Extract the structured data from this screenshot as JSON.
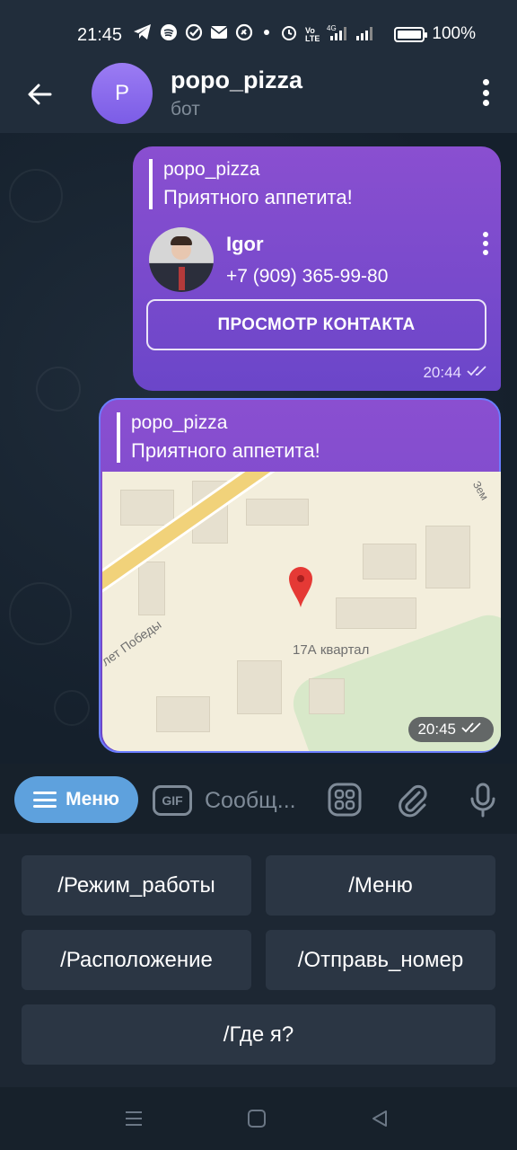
{
  "status_bar": {
    "time": "21:45",
    "battery": "100%",
    "icons": [
      "telegram-icon",
      "spotify-icon",
      "check-circle-icon",
      "mail-icon",
      "shazam-icon",
      "dot-icon",
      "alarm-icon",
      "volte-icon",
      "signal-4g-icon",
      "signal-icon",
      "battery-icon"
    ]
  },
  "header": {
    "avatar_letter": "P",
    "title": "popo_pizza",
    "subtitle": "бот"
  },
  "messages": [
    {
      "reply_name": "popo_pizza",
      "reply_text": "Приятного аппетита!",
      "contact_name": "Igor",
      "contact_phone": "+7 (909) 365-99-80",
      "view_contact_label": "ПРОСМОТР КОНТАКТА",
      "time": "20:44"
    },
    {
      "reply_name": "popo_pizza",
      "reply_text": "Приятного аппетита!",
      "map_labels": [
        "17А квартал",
        "лет Победы",
        "Зем"
      ],
      "time": "20:45"
    }
  ],
  "input_bar": {
    "menu_label": "Меню",
    "gif_label": "GIF",
    "placeholder": "Сообщ..."
  },
  "keyboard": {
    "buttons": [
      "/Режим_работы",
      "/Меню",
      "/Расположение",
      "/Отправь_номер",
      "/Где я?"
    ]
  },
  "colors": {
    "bubble": "#7a4bcd",
    "menu_button": "#5ea1dd",
    "background": "#17212b"
  }
}
